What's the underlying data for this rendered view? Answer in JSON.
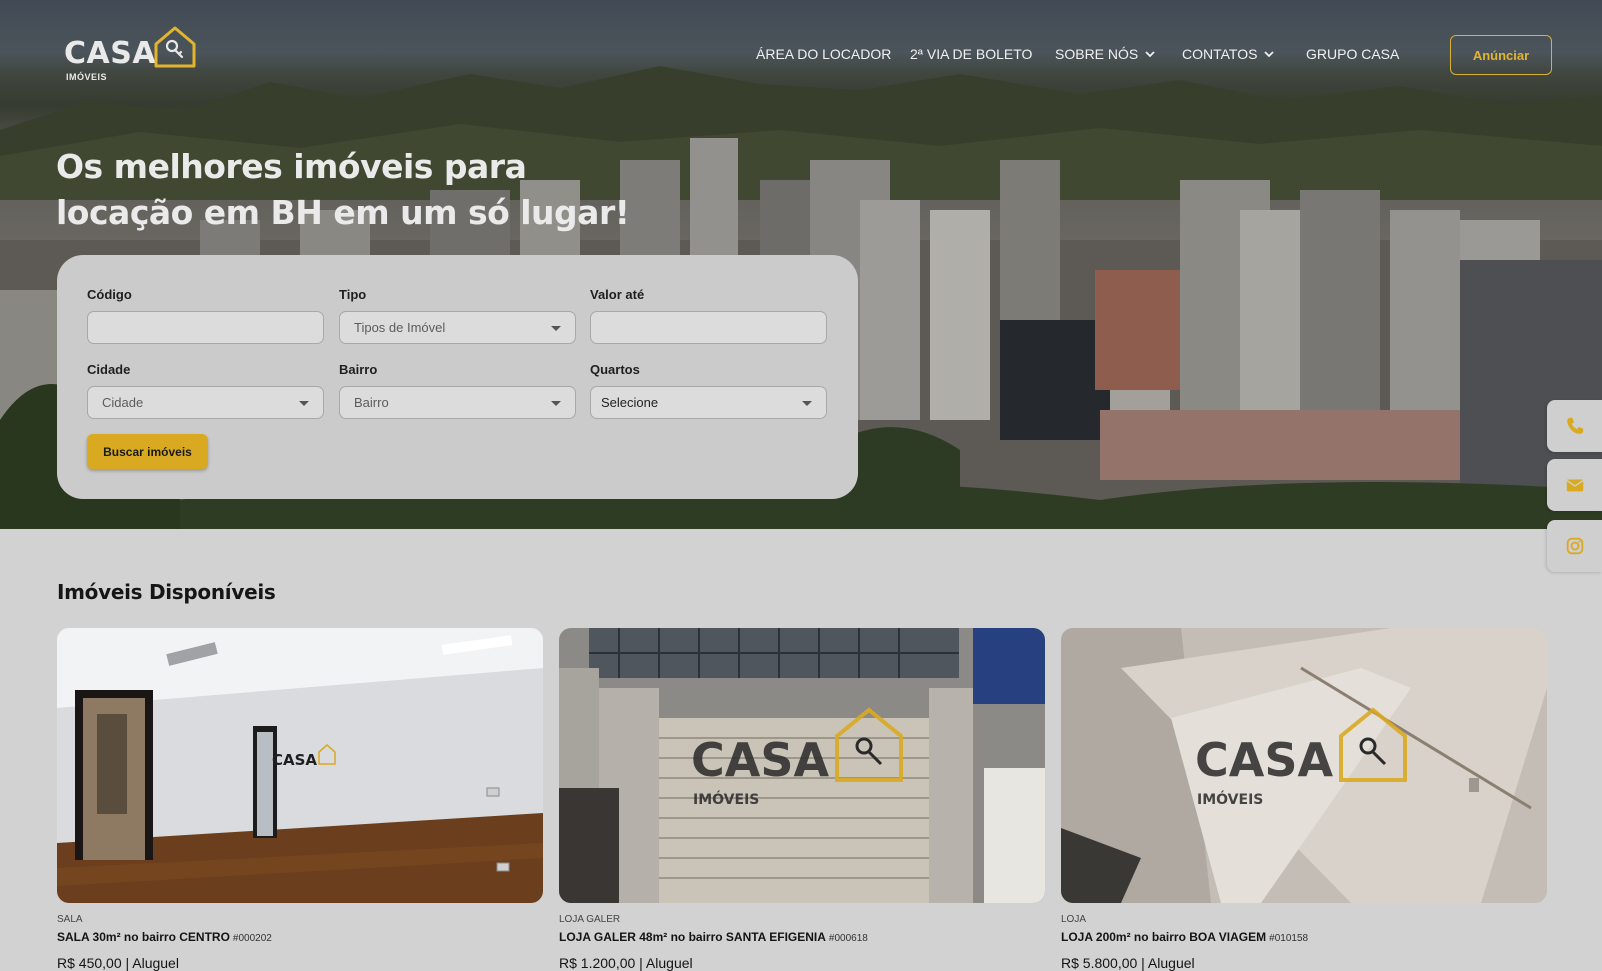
{
  "brand": {
    "name": "CASA",
    "sub": "IMÓVEIS"
  },
  "nav": {
    "items": [
      {
        "label": "ÁREA DO LOCADOR",
        "dropdown": false
      },
      {
        "label": "2ª VIA DE BOLETO",
        "dropdown": false
      },
      {
        "label": "SOBRE NÓS",
        "dropdown": true
      },
      {
        "label": "CONTATOS",
        "dropdown": true
      },
      {
        "label": "GRUPO CASA",
        "dropdown": false
      }
    ],
    "cta": "Anúnciar"
  },
  "hero": {
    "headline_line1": "Os melhores imóveis para",
    "headline_line2": "locação em BH em um só lugar!"
  },
  "search": {
    "codigo": {
      "label": "Código",
      "value": ""
    },
    "tipo": {
      "label": "Tipo",
      "value": "Tipos de Imóvel"
    },
    "valor": {
      "label": "Valor até",
      "value": ""
    },
    "cidade": {
      "label": "Cidade",
      "value": "Cidade"
    },
    "bairro": {
      "label": "Bairro",
      "value": "Bairro"
    },
    "quartos": {
      "label": "Quartos",
      "value": "Selecione"
    },
    "button": "Buscar imóveis"
  },
  "side_icons": [
    "phone-icon",
    "mail-icon",
    "instagram-icon"
  ],
  "listings": {
    "title": "Imóveis Disponíveis",
    "cards": [
      {
        "type": "SALA",
        "title": "SALA 30m² no bairro CENTRO",
        "code": "#000202",
        "price": "R$ 450,00 | Aluguel"
      },
      {
        "type": "LOJA GALER",
        "title": "LOJA GALER 48m² no bairro SANTA EFIGENIA",
        "code": "#000618",
        "price": "R$ 1.200,00 | Aluguel"
      },
      {
        "type": "LOJA",
        "title": "LOJA 200m² no bairro BOA VIAGEM",
        "code": "#010158",
        "price": "R$ 5.800,00 | Aluguel"
      }
    ],
    "watermark": {
      "word": "CASA",
      "sub": "IMÓVEIS"
    }
  },
  "colors": {
    "accent": "#d9aa21",
    "page_bg": "#d2d2d2",
    "panel_bg": "#cbcbcb"
  }
}
